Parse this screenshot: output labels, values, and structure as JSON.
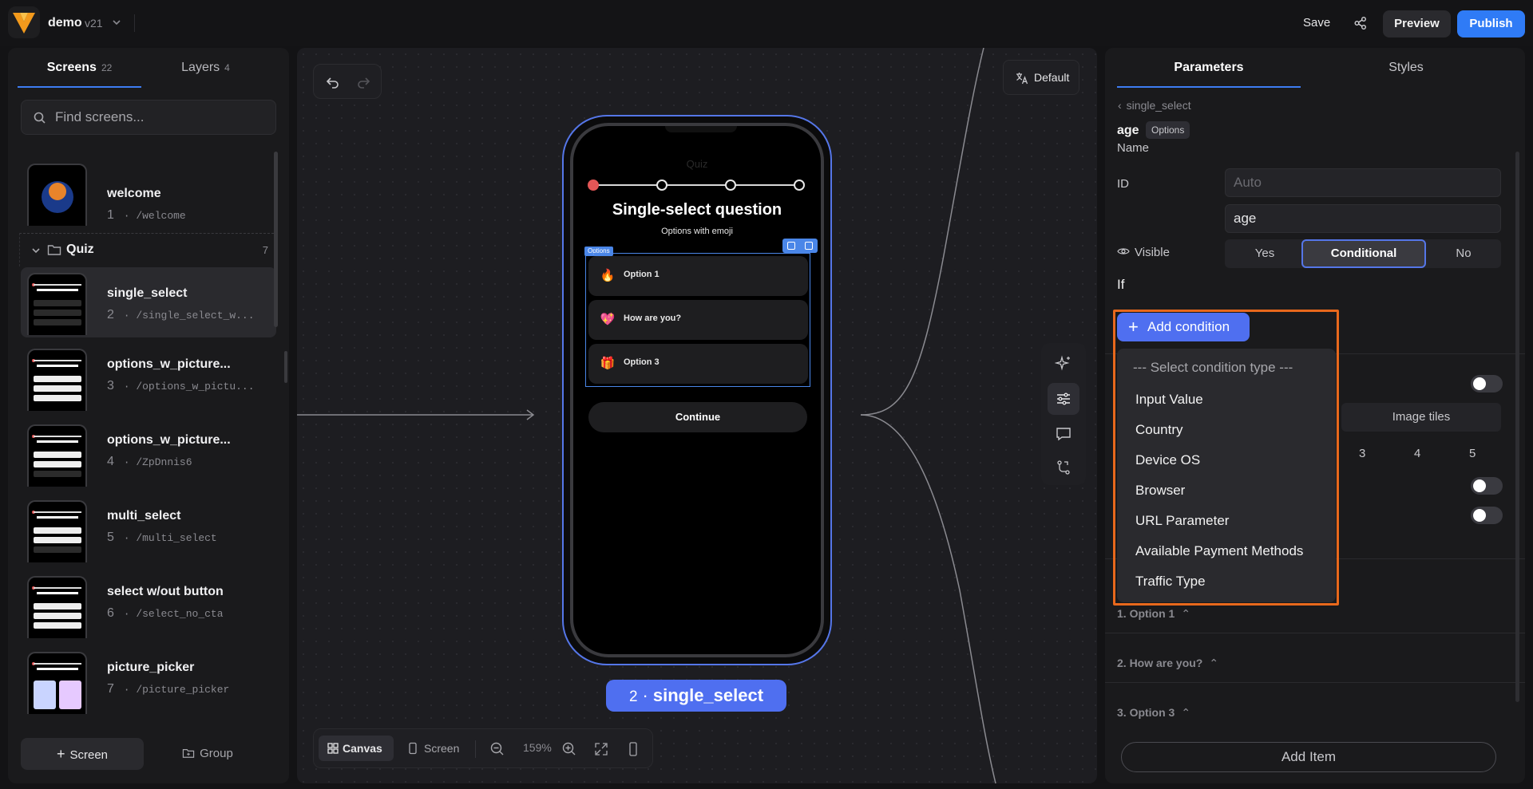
{
  "app": {
    "name": "demo",
    "version": "v21",
    "save_label": "Save",
    "preview_label": "Preview",
    "publish_label": "Publish",
    "accent": "#2f7bf6"
  },
  "left_panel": {
    "tabs": [
      {
        "label": "Screens",
        "count": "22"
      },
      {
        "label": "Layers",
        "count": "4"
      }
    ],
    "search_placeholder": "Find screens...",
    "screens": [
      {
        "name": "welcome",
        "number": "1",
        "path": "/welcome"
      },
      {
        "name": "single_select",
        "number": "2",
        "path": "/single_select_w..."
      },
      {
        "name": "options_w_picture...",
        "number": "3",
        "path": "/options_w_pictu..."
      },
      {
        "name": "options_w_picture...",
        "number": "4",
        "path": "/ZpDnnis6"
      },
      {
        "name": "multi_select",
        "number": "5",
        "path": "/multi_select"
      },
      {
        "name": "select w/out button",
        "number": "6",
        "path": "/select_no_cta"
      },
      {
        "name": "picture_picker",
        "number": "7",
        "path": "/picture_picker"
      }
    ],
    "group": {
      "label": "Quiz",
      "count": "7"
    },
    "add_screen_label": "Screen",
    "add_group_label": "Group"
  },
  "canvas": {
    "language_label": "Default",
    "phone": {
      "ghost_title": "Quiz",
      "title": "Single-select question",
      "subtitle": "Options with emoji",
      "options_tag": "Options",
      "options": [
        {
          "label": "Option 1",
          "emoji": "🔥"
        },
        {
          "label": "How are you?",
          "emoji": "💖"
        },
        {
          "label": "Option 3",
          "emoji": "🎁"
        }
      ],
      "continue_label": "Continue"
    },
    "screen_chip": {
      "number": "2",
      "separator": "·",
      "name": "single_select"
    },
    "bottom_bar": {
      "canvas_label": "Canvas",
      "screen_label": "Screen",
      "zoom": "159%"
    }
  },
  "right_panel": {
    "tabs": [
      "Parameters",
      "Styles"
    ],
    "breadcrumb": "single_select",
    "element_name": "age",
    "element_badge": "Options",
    "fields": {
      "name_label": "Name",
      "name_placeholder": "Auto",
      "id_label": "ID",
      "id_value": "age",
      "visible_label": "Visible",
      "visible_options": [
        "Yes",
        "Conditional",
        "No"
      ],
      "visible_selected": "Conditional",
      "if_label": "If"
    },
    "image_tiles_label": "Image tiles",
    "column_numbers": [
      "3",
      "4",
      "5"
    ],
    "items": [
      "1. Option 1",
      "2. How are you?",
      "3. Option 3"
    ],
    "add_item_label": "Add Item",
    "add_condition_label": "Add condition",
    "condition_menu": {
      "placeholder": "--- Select condition type ---",
      "options": [
        "Input Value",
        "Country",
        "Device OS",
        "Browser",
        "URL Parameter",
        "Available Payment Methods",
        "Traffic Type"
      ]
    },
    "highlight_color": "#e8681c"
  }
}
